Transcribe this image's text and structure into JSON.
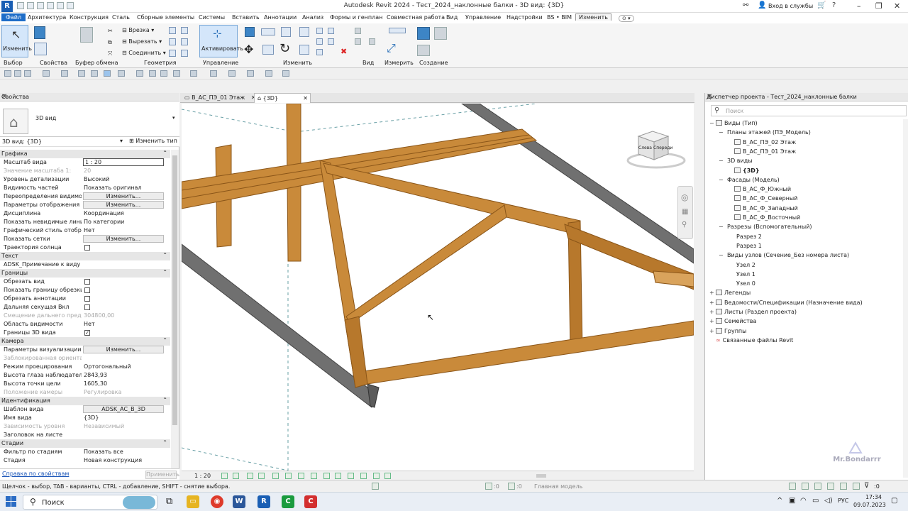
{
  "window": {
    "title": "Autodesk Revit 2024 - Тест_2024_наклонные балки - 3D вид: {3D}",
    "app_logo": "R",
    "signin": "Вход в службы"
  },
  "menu_tabs": [
    "Файл",
    "Архитектура",
    "Конструкция",
    "Сталь",
    "Сборные элементы",
    "Системы",
    "Вставить",
    "Аннотации",
    "Анализ",
    "Формы и генплан",
    "Совместная работа",
    "Вид",
    "Управление",
    "Надстройки",
    "BS • BIM",
    "Изменить"
  ],
  "ribbon": {
    "modify_label": "Изменить",
    "cut_label": "Врезка",
    "cut2_label": "Вырезать",
    "join_label": "Соединить",
    "activate_label": "Активировать",
    "panels": [
      "Выбор",
      "Свойства",
      "Буфер обмена",
      "Геометрия",
      "Управление",
      "Изменить",
      "Вид",
      "Измерить",
      "Создание"
    ]
  },
  "properties": {
    "header": "Свойства",
    "type_name": "3D вид",
    "filter": "3D вид: {3D}",
    "edit_type": "Изменить тип",
    "sections": [
      {
        "title": "Графика",
        "rows": [
          {
            "k": "Масштаб вида",
            "v": "1 : 20",
            "kind": "input"
          },
          {
            "k": "Значение масштаба    1:",
            "v": "20",
            "kind": "dis"
          },
          {
            "k": "Уровень детализации",
            "v": "Высокий"
          },
          {
            "k": "Видимость частей",
            "v": "Показать оригинал"
          },
          {
            "k": "Переопределения видимос...",
            "v": "Изменить...",
            "kind": "btn"
          },
          {
            "k": "Параметры отображения г...",
            "v": "Изменить...",
            "kind": "btn"
          },
          {
            "k": "Дисциплина",
            "v": "Координация"
          },
          {
            "k": "Показать невидимые линии",
            "v": "По категории"
          },
          {
            "k": "Графический стиль отобра...",
            "v": "Нет"
          },
          {
            "k": "Показать сетки",
            "v": "Изменить...",
            "kind": "btn"
          },
          {
            "k": "Траектория солнца",
            "v": "",
            "kind": "cb"
          }
        ]
      },
      {
        "title": "Текст",
        "rows": [
          {
            "k": "ADSK_Примечание к виду",
            "v": ""
          }
        ]
      },
      {
        "title": "Границы",
        "rows": [
          {
            "k": "Обрезать вид",
            "v": "",
            "kind": "cb"
          },
          {
            "k": "Показать границу обрезки",
            "v": "",
            "kind": "cb"
          },
          {
            "k": "Обрезать аннотации",
            "v": "",
            "kind": "cb"
          },
          {
            "k": "Дальняя секущая Вкл",
            "v": "",
            "kind": "cb"
          },
          {
            "k": "Смещение дальнего предел...",
            "v": "304800,00",
            "kind": "dis"
          },
          {
            "k": "Область видимости",
            "v": "Нет"
          },
          {
            "k": "Границы 3D вида",
            "v": "✓",
            "kind": "cbc"
          }
        ]
      },
      {
        "title": "Камера",
        "rows": [
          {
            "k": "Параметры визуализации",
            "v": "Изменить...",
            "kind": "btn"
          },
          {
            "k": "Заблокированная ориентац...",
            "v": "",
            "kind": "dis"
          },
          {
            "k": "Режим проецирования",
            "v": "Ортогональный"
          },
          {
            "k": "Высота глаза наблюдателя",
            "v": "2843,93"
          },
          {
            "k": "Высота точки цели",
            "v": "1605,30"
          },
          {
            "k": "Положение камеры",
            "v": "Регулировка",
            "kind": "dis"
          }
        ]
      },
      {
        "title": "Идентификация",
        "rows": [
          {
            "k": "Шаблон вида",
            "v": "ADSK_АС_В_3D",
            "kind": "btn"
          },
          {
            "k": "Имя вида",
            "v": "{3D}"
          },
          {
            "k": "Зависимость уровня",
            "v": "Независимый",
            "kind": "dis"
          },
          {
            "k": "Заголовок на листе",
            "v": ""
          }
        ]
      },
      {
        "title": "Стадии",
        "rows": [
          {
            "k": "Фильтр по стадиям",
            "v": "Показать все"
          },
          {
            "k": "Стадия",
            "v": "Новая конструкция"
          }
        ]
      }
    ],
    "help_link": "Справка по свойствам",
    "apply": "Применить"
  },
  "view_tabs": [
    "В_АС_ПЭ_01 Этаж",
    "{3D}"
  ],
  "viewcube": {
    "left": "Слева",
    "front": "Спереди"
  },
  "view_scale": "1 : 20",
  "browser": {
    "header": "Диспетчер проекта - Тест_2024_наклонные балки",
    "search_placeholder": "Поиск",
    "tree": [
      {
        "lvl": 0,
        "tog": "−",
        "icon": true,
        "t": "Виды (Тип)"
      },
      {
        "lvl": 1,
        "tog": "−",
        "icon": false,
        "t": "Планы этажей (ПЭ_Модель)"
      },
      {
        "lvl": 2,
        "tog": "",
        "icon": true,
        "t": "В_АС_ПЭ_02 Этаж"
      },
      {
        "lvl": 2,
        "tog": "",
        "icon": true,
        "t": "В_АС_ПЭ_01 Этаж"
      },
      {
        "lvl": 1,
        "tog": "−",
        "icon": false,
        "t": "3D виды"
      },
      {
        "lvl": 2,
        "tog": "",
        "icon": true,
        "t": "{3D}",
        "bold": true
      },
      {
        "lvl": 1,
        "tog": "−",
        "icon": false,
        "t": "Фасады (Модель)"
      },
      {
        "lvl": 2,
        "tog": "",
        "icon": true,
        "t": "В_АС_Ф_Южный"
      },
      {
        "lvl": 2,
        "tog": "",
        "icon": true,
        "t": "В_АС_Ф_Северный"
      },
      {
        "lvl": 2,
        "tog": "",
        "icon": true,
        "t": "В_АС_Ф_Западный"
      },
      {
        "lvl": 2,
        "tog": "",
        "icon": true,
        "t": "В_АС_Ф_Восточный"
      },
      {
        "lvl": 1,
        "tog": "−",
        "icon": false,
        "t": "Разрезы (Вспомогательный)"
      },
      {
        "lvl": 2,
        "tog": "",
        "icon": false,
        "t": "Разрез 2"
      },
      {
        "lvl": 2,
        "tog": "",
        "icon": false,
        "t": "Разрез 1"
      },
      {
        "lvl": 1,
        "tog": "−",
        "icon": false,
        "t": "Виды узлов (Сечение_Без номера листа)"
      },
      {
        "lvl": 2,
        "tog": "",
        "icon": false,
        "t": "Узел 2"
      },
      {
        "lvl": 2,
        "tog": "",
        "icon": false,
        "t": "Узел 1"
      },
      {
        "lvl": 2,
        "tog": "",
        "icon": false,
        "t": "Узел 0"
      },
      {
        "lvl": 0,
        "tog": "+",
        "icon": true,
        "t": "Легенды"
      },
      {
        "lvl": 0,
        "tog": "+",
        "icon": true,
        "t": "Ведомости/Спецификации (Назначение вида)"
      },
      {
        "lvl": 0,
        "tog": "+",
        "icon": true,
        "t": "Листы (Раздел проекта)"
      },
      {
        "lvl": 0,
        "tog": "+",
        "icon": true,
        "t": "Семейства"
      },
      {
        "lvl": 0,
        "tog": "+",
        "icon": true,
        "t": "Группы"
      },
      {
        "lvl": 0,
        "tog": "",
        "icon": false,
        "t": "Связанные файлы Revit",
        "link": true
      }
    ]
  },
  "status": {
    "text": "Щелчок - выбор, TAB - варианты, CTRL - добавление, SHIFT - снятие выбора.",
    "main_model": "Главная модель",
    "zero1": ":0",
    "zero2": ":0"
  },
  "taskbar": {
    "search": "Поиск",
    "lang": "РУС",
    "time": "17:34",
    "date": "09.07.2023"
  },
  "watermark": "Mr.Bondarrr",
  "colors": {
    "wood": "#c98a3a",
    "wood_dark": "#9a6222",
    "steel": "#6e6e6e",
    "accent": "#1e6dc8"
  }
}
